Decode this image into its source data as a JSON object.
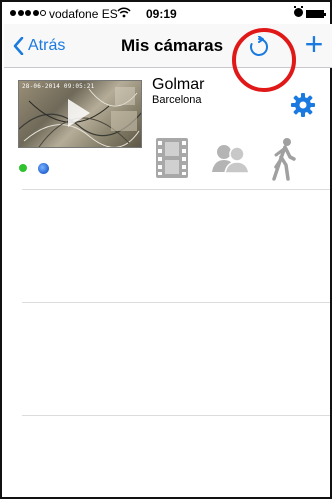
{
  "status_bar": {
    "carrier": "vodafone ES",
    "wifi_icon": "wifi-icon",
    "time": "09:19",
    "alarm_icon": "alarm-icon",
    "battery_icon": "battery-icon"
  },
  "nav": {
    "back_label": "Atrás",
    "title": "Mis cámaras",
    "refresh_icon": "refresh-icon",
    "add_label": "+"
  },
  "camera": {
    "name": "Golmar",
    "location": "Barcelona",
    "thumbnail_timestamp": "28-06-2014 09:05:21",
    "online": true,
    "status_color": "#2fc32f",
    "actions": [
      "film-icon",
      "people-icon",
      "walker-icon"
    ]
  },
  "colors": {
    "accent": "#1a7ae0",
    "highlight": "#e01818"
  }
}
